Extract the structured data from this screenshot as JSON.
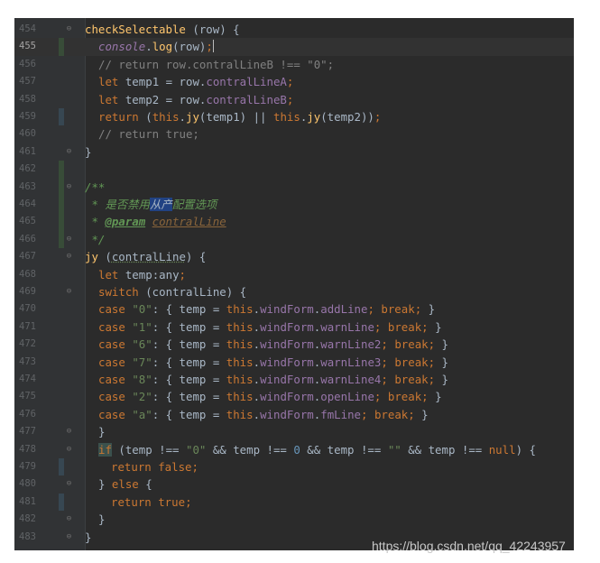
{
  "editor": {
    "line_numbers": [
      "454",
      "455",
      "456",
      "457",
      "458",
      "459",
      "460",
      "461",
      "462",
      "463",
      "464",
      "465",
      "466",
      "467",
      "468",
      "469",
      "470",
      "471",
      "472",
      "473",
      "474",
      "475",
      "476",
      "477",
      "478",
      "479",
      "480",
      "481",
      "482",
      "483"
    ],
    "code": {
      "l454_a": "checkSelectable",
      "l454_b": " (row) {",
      "l455_a": "console",
      "l455_b": ".",
      "l455_c": "log",
      "l455_d": "(row)",
      "l455_e": ";",
      "l456": "// return row.contralLineB !== \"0\";",
      "l457_kw": "let",
      "l457_a": " temp1 = row.",
      "l457_prop": "contralLineA",
      "l457_end": ";",
      "l458_kw": "let",
      "l458_a": " temp2 = row.",
      "l458_prop": "contralLineB",
      "l458_end": ";",
      "l459_kw": "return",
      "l459_a": " (",
      "l459_this1": "this",
      "l459_b": ".",
      "l459_fn1": "jy",
      "l459_c": "(temp1) || ",
      "l459_this2": "this",
      "l459_d": ".",
      "l459_fn2": "jy",
      "l459_e": "(temp2))",
      "l459_end": ";",
      "l460": "// return true;",
      "l461": "}",
      "l463": "/**",
      "l464_a": " * 是否禁用",
      "l464_sel": "从产",
      "l464_b": "配置选项",
      "l465_a": " * ",
      "l465_tag": "@param",
      "l465_sp": " ",
      "l465_param": "contralLine",
      "l466": " */",
      "l467_fn": "jy",
      "l467_a": " (",
      "l467_arg": "contralLine",
      "l467_b": ") {",
      "l468_kw": "let",
      "l468_a": " temp:any",
      "l468_end": ";",
      "l469_kw": "switch",
      "l469_a": " (contralLine) {",
      "cases": [
        {
          "val": "\"0\"",
          "prop": "addLine"
        },
        {
          "val": "\"1\"",
          "prop": "warnLine"
        },
        {
          "val": "\"6\"",
          "prop": "warnLine2"
        },
        {
          "val": "\"7\"",
          "prop": "warnLine3"
        },
        {
          "val": "\"8\"",
          "prop": "warnLine4"
        },
        {
          "val": "\"2\"",
          "prop": "openLine"
        },
        {
          "val": "\"a\"",
          "prop": "fmLine"
        }
      ],
      "case_kw": "case",
      "case_colon": ": { temp = ",
      "this_kw": "this",
      "dot": ".",
      "wind": "windForm",
      "semi": ";",
      "break_kw": "break",
      "close": " }",
      "l477": "}",
      "l478_if": "if",
      "l478_a": " (temp !== ",
      "l478_s0": "\"0\"",
      "l478_b": " && temp !== ",
      "l478_n0": "0",
      "l478_c": " && temp !== ",
      "l478_se": "\"\"",
      "l478_d": " && temp !== ",
      "l478_null": "null",
      "l478_e": ") {",
      "l479_kw": "return false",
      "l479_end": ";",
      "l480_a": "} ",
      "l480_kw": "else",
      "l480_b": " {",
      "l481_kw": "return true",
      "l481_end": ";",
      "l482": "}",
      "l483": "}"
    }
  },
  "watermark": "https://blog.csdn.net/qq_42243957"
}
